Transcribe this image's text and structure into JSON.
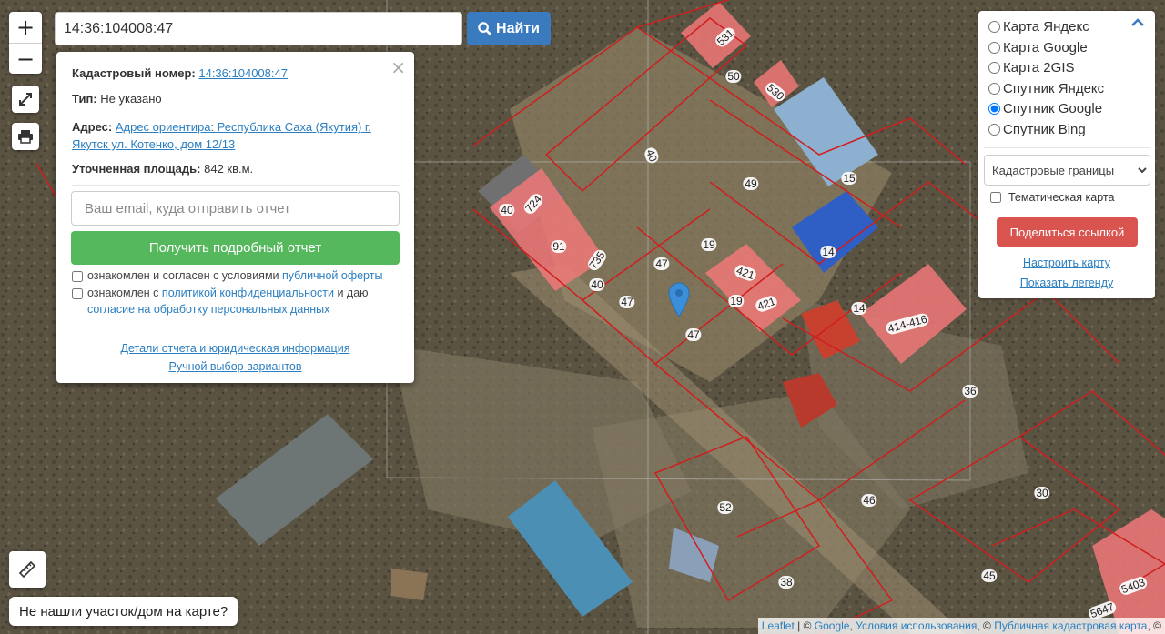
{
  "search": {
    "value": "14:36:104008:47",
    "button_label": "Найти"
  },
  "zoom": {
    "in": "+",
    "out": "−"
  },
  "popup": {
    "cadastral_label": "Кадастровый номер:",
    "cadastral_value": "14:36:104008:47",
    "type_label": "Тип:",
    "type_value": "Не указано",
    "address_label": "Адрес:",
    "address_line1": "Адрес ориентира: Республика Саха (Якутия) г.",
    "address_line2": "Якутск ул. Котенко, дом 12/13",
    "area_label": "Уточненная площадь:",
    "area_value": "842 кв.м.",
    "email_placeholder": "Ваш email, куда отправить отчет",
    "report_button": "Получить подробный отчет",
    "consent1_text": "ознакомлен и согласен с условиями",
    "consent1_link": "публичной оферты",
    "consent2_text1": "ознакомлен с",
    "consent2_link1": "политикой конфиденциальности",
    "consent2_text2": "и даю",
    "consent2_link2": "согласие на обработку персональных данных",
    "details_link": "Детали отчета и юридическая информация",
    "manual_link": "Ручной выбор вариантов"
  },
  "layers": {
    "options": [
      {
        "label": "Карта Яндекс",
        "selected": false
      },
      {
        "label": "Карта Google",
        "selected": false
      },
      {
        "label": "Карта 2GIS",
        "selected": false
      },
      {
        "label": "Спутник Яндекс",
        "selected": false
      },
      {
        "label": "Спутник Google",
        "selected": true
      },
      {
        "label": "Спутник Bing",
        "selected": false
      }
    ],
    "overlay_select": "Кадастровые границы",
    "thematic_label": "Тематическая карта",
    "share_button": "Поделиться ссылкой",
    "configure_link": "Настроить карту",
    "legend_link": "Показать легенду"
  },
  "not_found_button": "Не нашли участок/дом на карте?",
  "attribution": {
    "leaflet": "Leaflet",
    "sep1": " | © ",
    "google": "Google",
    "sep2": ", ",
    "terms": "Условия использования",
    "sep3": ", © ",
    "pkk": "Публичная кадастровая карта",
    "sep4": ", ©"
  },
  "map_labels": [
    "531",
    "50",
    "530",
    "40",
    "49",
    "15",
    "40",
    "724",
    "91",
    "735",
    "19",
    "14",
    "47",
    "421",
    "421",
    "19",
    "40",
    "47",
    "47",
    "14",
    "414-416",
    "36",
    "52",
    "46",
    "30",
    "38",
    "45",
    "5403",
    "5647"
  ],
  "colors": {
    "parcel_border": "#d01e1e",
    "building_fill": "#f07878",
    "marker": "#3b8fd9",
    "find_button": "#3a7bbf",
    "report_button": "#55b85c",
    "share_button": "#d9534f"
  }
}
